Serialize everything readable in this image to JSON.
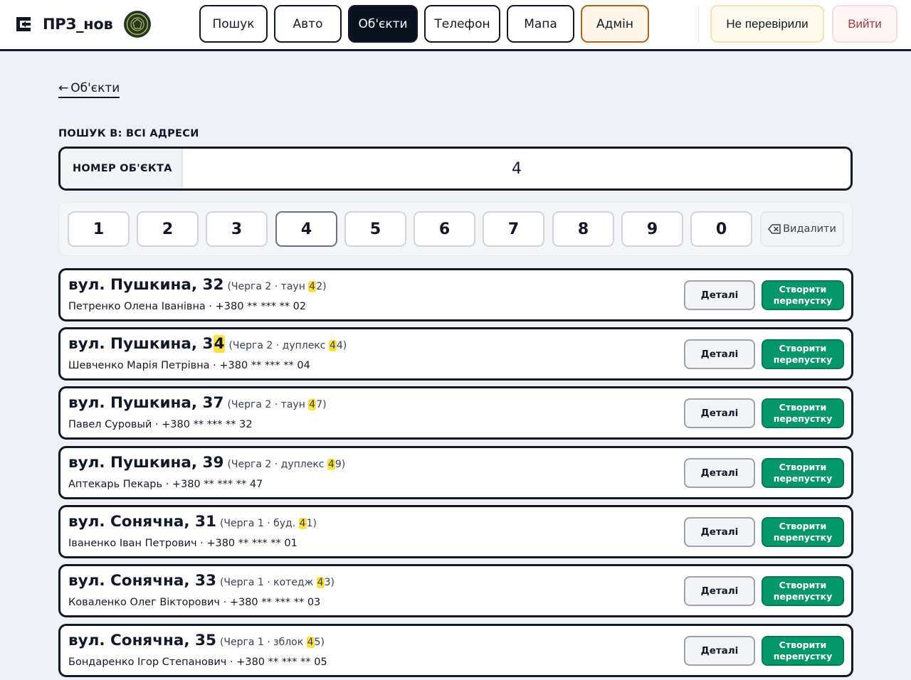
{
  "header": {
    "app_name": "ПРЗ_нов",
    "nav": [
      {
        "label": "Пошук",
        "active": false
      },
      {
        "label": "Авто",
        "active": false
      },
      {
        "label": "Об'єкти",
        "active": true
      },
      {
        "label": "Телефон",
        "active": false
      },
      {
        "label": "Мапа",
        "active": false
      },
      {
        "label": "Адмін",
        "active": false
      }
    ],
    "unchecked_label": "Не перевірили",
    "logout_label": "Вийти"
  },
  "back_link": {
    "arrow": "←",
    "label": "Об'єкти"
  },
  "search": {
    "scope_label": "ПОШУК В: ВСІ АДРЕСИ",
    "field_label": "НОМЕР ОБ'ЄКТА",
    "value": "4"
  },
  "keypad": {
    "keys": [
      "1",
      "2",
      "3",
      "4",
      "5",
      "6",
      "7",
      "8",
      "9",
      "0"
    ],
    "pressed_key": "4",
    "delete_label": "Видалити"
  },
  "results": [
    {
      "address": "вул. Пушкина, 32",
      "meta_pre": "(Черга 2 · таун ",
      "meta_hl": "4",
      "meta_post": "2)",
      "owner": "Петренко Олена Іванівна · +380 ** *** ** 02"
    },
    {
      "address_pre": "вул. Пушкина, 3",
      "address_hl": "4",
      "address": "",
      "meta_pre": "(Черга 2 · дуплекс ",
      "meta_hl": "4",
      "meta_post": "4)",
      "owner": "Шевченко Марія Петрівна · +380 ** *** ** 04"
    },
    {
      "address": "вул. Пушкина, 37",
      "meta_pre": "(Черга 2 · таун ",
      "meta_hl": "4",
      "meta_post": "7)",
      "owner": "Павел Суровый · +380 ** *** ** 32"
    },
    {
      "address": "вул. Пушкина, 39",
      "meta_pre": "(Черга 2 · дуплекс ",
      "meta_hl": "4",
      "meta_post": "9)",
      "owner": "Аптекарь Пекарь · +380 ** *** ** 47"
    },
    {
      "address": "вул. Сонячна, 31",
      "meta_pre": "(Черга 1 · буд. ",
      "meta_hl": "4",
      "meta_post": "1)",
      "owner": "Іваненко Іван Петрович · +380 ** *** ** 01"
    },
    {
      "address": "вул. Сонячна, 33",
      "meta_pre": "(Черга 1 · котедж ",
      "meta_hl": "4",
      "meta_post": "3)",
      "owner": "Коваленко Олег Вікторович · +380 ** *** ** 03"
    },
    {
      "address": "вул. Сонячна, 35",
      "meta_pre": "(Черга 1 · зблок ",
      "meta_hl": "4",
      "meta_post": "5)",
      "owner": "Бондаренко Ігор Степанович · +380 ** *** ** 05"
    }
  ],
  "result_actions": {
    "details_label": "Деталі",
    "create_label": "Створити перепустку"
  },
  "colors": {
    "primary_dark": "#0b1220",
    "admin_border": "#b2621c",
    "create_green": "#059669",
    "highlight": "#fde047",
    "logout_text": "#a33a3a"
  }
}
